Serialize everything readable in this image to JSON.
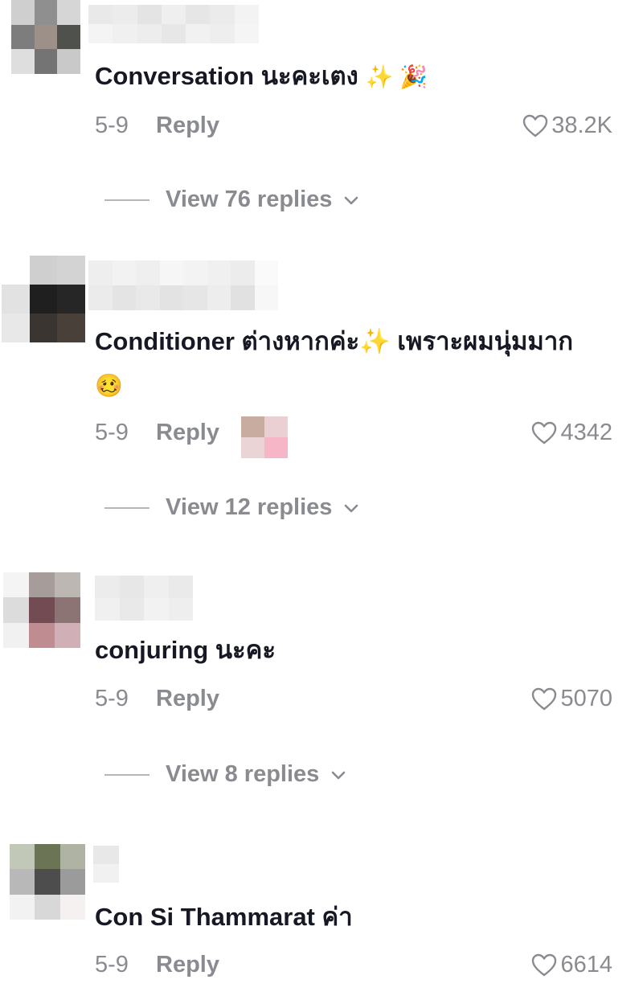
{
  "comments": [
    {
      "text": "Conversation นะคะเตง",
      "emoji": "✨ 🎉",
      "date": "5-9",
      "reply_label": "Reply",
      "likes": "38.2K",
      "view_replies": "View 76 replies"
    },
    {
      "text": "Conditioner ต่างหากค่ะ✨ เพราะผมนุ่มมาก",
      "emoji": "🥴",
      "date": "5-9",
      "reply_label": "Reply",
      "likes": "4342",
      "view_replies": "View 12 replies"
    },
    {
      "text": "conjuring นะคะ",
      "date": "5-9",
      "reply_label": "Reply",
      "likes": "5070",
      "view_replies": "View 8 replies"
    },
    {
      "text": "Con Si Thammarat ค่า",
      "date": "5-9",
      "reply_label": "Reply",
      "likes": "6614"
    }
  ],
  "colors": {
    "text": "#161823",
    "meta": "#8a8b91",
    "heart_outline": "#8a8b91"
  },
  "icons": {
    "like": "heart-outline-icon",
    "expand": "chevron-down-icon"
  }
}
